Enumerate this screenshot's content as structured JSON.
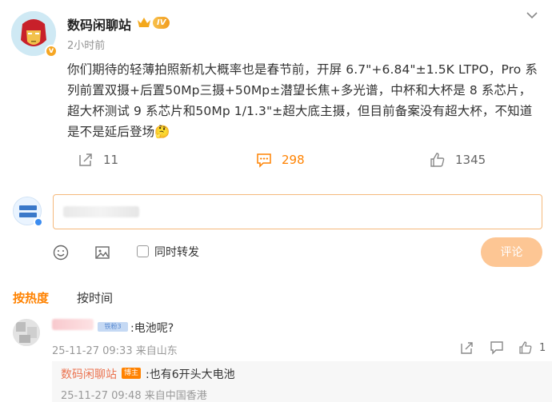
{
  "post": {
    "author": "数码闲聊站",
    "level": "IV",
    "time": "2小时前",
    "text": "你们期待的轻薄拍照新机大概率也是春节前，开屏 6.7\"+6.84\"±1.5K LTPO，Pro 系列前置双摄+后置50Mp三摄+50Mp±潜望长焦+多光谱，中杯和大杯是 8 系芯片，超大杯测试 9 系芯片和50Mp 1/1.3\"±超大底主摄，但目前备案没有超大杯，不知道是不是延后登场",
    "emoji": "🤔"
  },
  "actions": {
    "repost_count": "11",
    "comment_count": "298",
    "like_count": "1345"
  },
  "composer": {
    "forward_label": "同时转发",
    "submit_label": "评论"
  },
  "sort_tabs": {
    "hot": "按热度",
    "time": "按时间"
  },
  "comments": [
    {
      "fan_badge": "铁粉3",
      "text": ":电池呢?",
      "meta": "25-11-27 09:33 来自山东",
      "like_count": "1",
      "reply": {
        "author": "数码闲聊站",
        "tag": "博主",
        "text": ":也有6开头大电池",
        "meta": "25-11-27 09:48 来自中国香港"
      }
    }
  ],
  "colors": {
    "accent": "#ff8200",
    "submit_bg": "#fdc694",
    "name_link": "#eb7350"
  }
}
